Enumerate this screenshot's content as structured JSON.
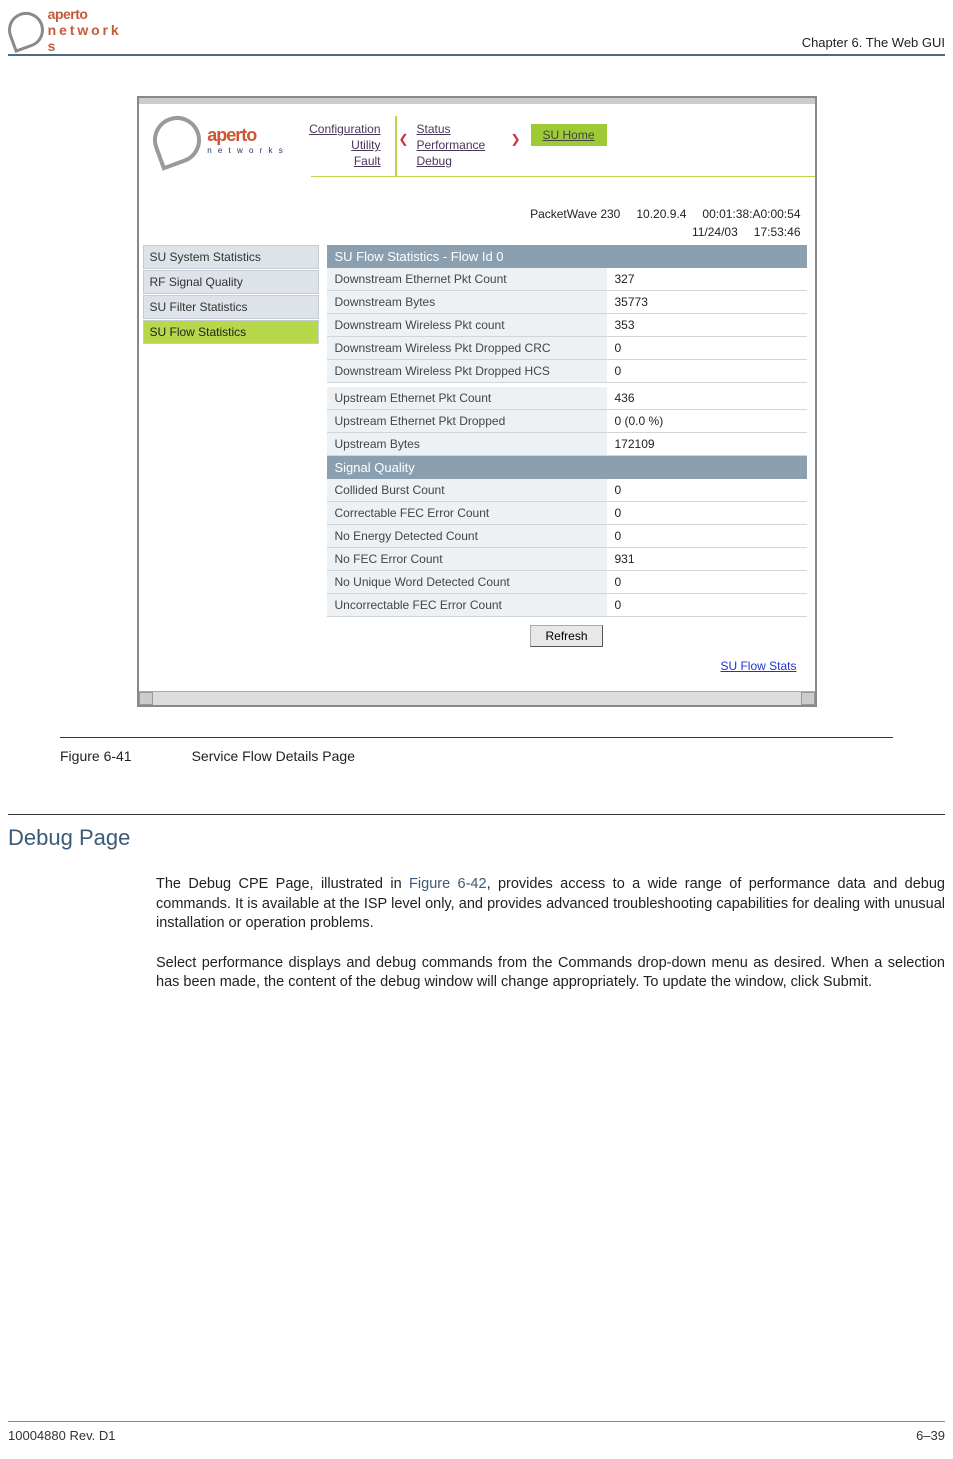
{
  "page_header": {
    "logo_text": "aperto",
    "logo_sub": "n e t w o r k s",
    "chapter": "Chapter 6.  The Web GUI"
  },
  "screenshot": {
    "logo_text": "aperto",
    "logo_sub": "n e t w o r k s",
    "nav_left": [
      "Configuration",
      "Utility",
      "Fault"
    ],
    "nav_right": [
      "Status",
      "Performance",
      "Debug"
    ],
    "su_home": "SU Home",
    "info": {
      "device": "PacketWave 230",
      "ip": "10.20.9.4",
      "mac": "00:01:38:A0:00:54",
      "date": "11/24/03",
      "time": "17:53:46"
    },
    "sidebar": [
      {
        "label": "SU System Statistics",
        "active": false
      },
      {
        "label": "RF Signal Quality",
        "active": false
      },
      {
        "label": "SU Filter Statistics",
        "active": false
      },
      {
        "label": "SU Flow Statistics",
        "active": true
      }
    ],
    "table_title": "SU Flow Statistics - Flow Id 0",
    "rows1": [
      {
        "label": "Downstream Ethernet Pkt Count",
        "value": "327"
      },
      {
        "label": "Downstream Bytes",
        "value": "35773"
      },
      {
        "label": "Downstream Wireless Pkt count",
        "value": "353"
      },
      {
        "label": "Downstream Wireless Pkt Dropped CRC",
        "value": "0"
      },
      {
        "label": "Downstream Wireless Pkt Dropped HCS",
        "value": "0"
      }
    ],
    "rows2": [
      {
        "label": "Upstream Ethernet Pkt Count",
        "value": "436"
      },
      {
        "label": "Upstream Ethernet Pkt Dropped",
        "value": "0 (0.0 %)"
      },
      {
        "label": "Upstream Bytes",
        "value": "172109"
      }
    ],
    "section2_title": "Signal Quality",
    "rows3": [
      {
        "label": "Collided Burst Count",
        "value": "0"
      },
      {
        "label": "Correctable FEC Error Count",
        "value": "0"
      },
      {
        "label": "No Energy Detected Count",
        "value": "0"
      },
      {
        "label": "No FEC Error Count",
        "value": "931"
      },
      {
        "label": "No Unique Word Detected Count",
        "value": "0"
      },
      {
        "label": "Uncorrectable FEC Error Count",
        "value": "0"
      }
    ],
    "refresh": "Refresh",
    "bottom_link": "SU Flow Stats"
  },
  "figure": {
    "number": "Figure 6-41",
    "title": "Service Flow Details Page"
  },
  "section": {
    "title": "Debug Page",
    "p1a": "The Debug CPE Page, illustrated in ",
    "p1ref": "Figure 6-42",
    "p1b": ", provides access to a wide range of performance data and debug commands. It is available at the ISP level only, and provides advanced troubleshooting capabilities for dealing with unusual installation or operation problems.",
    "p2": "Select performance displays and debug commands from the Commands drop-down menu as desired. When a selection has been made, the content of the debug window will change appropriately. To update the window, click Submit."
  },
  "footer": {
    "left": "10004880 Rev. D1",
    "right": "6–39"
  }
}
